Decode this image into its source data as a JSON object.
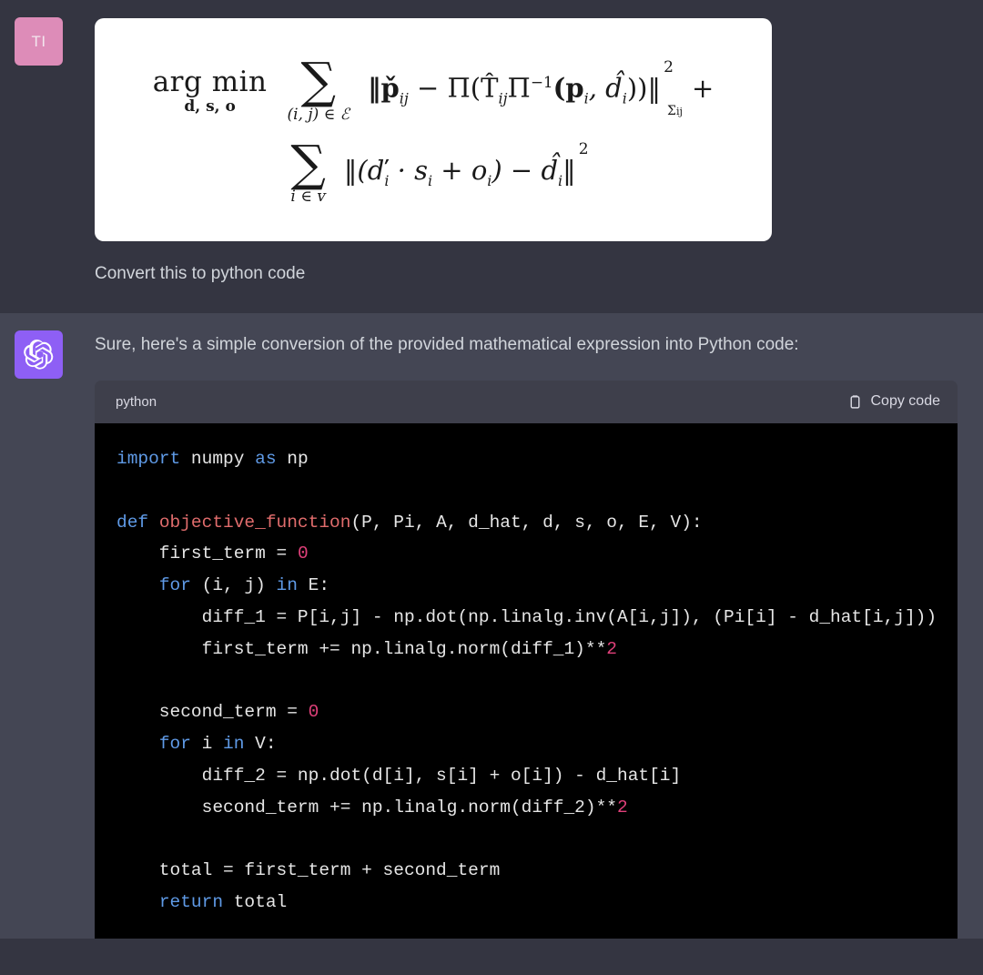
{
  "user_message": {
    "avatar_initials": "TI",
    "avatar_color": "#dd8cb8",
    "equation_alt": "arg min over d, s, o of sum over (i,j) in E of norm(p_check_ij - Pi(T_hat_ij Pi^-1(p_i, d_hat_i)))^2_Sigma_ij + sum over i in V of norm((d_check_i * s_i + o_i) - d_hat_i)^2",
    "equation": {
      "line1": {
        "argmin_top": "arg min",
        "argmin_bottom": "d, s, o",
        "sum_glyph": "∑",
        "sum_subscript": "(i, j) ∈ ℰ",
        "body_prefix": "‖p̌",
        "body_sub1": "ij",
        "body_mid": " − Π(T̂",
        "body_sub2": "ij",
        "body_mid2": "Π",
        "body_pow": "−1",
        "body_mid3": "(p",
        "body_sub3": "i",
        "body_mid4": ", d̂",
        "body_sub4": "i",
        "body_mid5": "))‖",
        "norm_power": "2",
        "norm_subscript": "Σ",
        "norm_subscript_idx": "ij",
        "trailing_plus": "+"
      },
      "line2": {
        "sum_glyph": "∑",
        "sum_subscript": "i ∈ ᴠ",
        "body_prefix": "‖(ď",
        "body_sub1": "i",
        "body_mid": " · s",
        "body_sub2": "i",
        "body_mid2": " + o",
        "body_sub3": "i",
        "body_mid3": ") − d̂",
        "body_sub4": "i",
        "body_suffix": "‖",
        "norm_power": "2"
      }
    },
    "text": "Convert this to python code"
  },
  "assistant_message": {
    "avatar_color": "#8e5ff5",
    "avatar_icon": "openai-logo-icon",
    "text": "Sure, here's a simple conversion of the provided mathematical expression into Python code:",
    "code_block": {
      "language": "python",
      "copy_label": "Copy code",
      "copy_icon": "clipboard-icon",
      "lines": [
        [
          {
            "t": "import",
            "c": "kw"
          },
          {
            "t": " numpy ",
            "c": "pl"
          },
          {
            "t": "as",
            "c": "kw"
          },
          {
            "t": " np",
            "c": "pl"
          }
        ],
        [],
        [
          {
            "t": "def",
            "c": "kw"
          },
          {
            "t": " ",
            "c": "pl"
          },
          {
            "t": "objective_function",
            "c": "fn"
          },
          {
            "t": "(P, Pi, A, d_hat, d, s, o, E, V):",
            "c": "pl"
          }
        ],
        [
          {
            "t": "    first_term = ",
            "c": "pl"
          },
          {
            "t": "0",
            "c": "num"
          }
        ],
        [
          {
            "t": "    ",
            "c": "pl"
          },
          {
            "t": "for",
            "c": "kw"
          },
          {
            "t": " (i, j) ",
            "c": "pl"
          },
          {
            "t": "in",
            "c": "kw"
          },
          {
            "t": " E:",
            "c": "pl"
          }
        ],
        [
          {
            "t": "        diff_1 = P[i,j] - np.dot(np.linalg.inv(A[i,j]), (Pi[i] - d_hat[i,j]))",
            "c": "pl"
          }
        ],
        [
          {
            "t": "        first_term += np.linalg.norm(diff_1)**",
            "c": "pl"
          },
          {
            "t": "2",
            "c": "num"
          }
        ],
        [],
        [
          {
            "t": "    second_term = ",
            "c": "pl"
          },
          {
            "t": "0",
            "c": "num"
          }
        ],
        [
          {
            "t": "    ",
            "c": "pl"
          },
          {
            "t": "for",
            "c": "kw"
          },
          {
            "t": " i ",
            "c": "pl"
          },
          {
            "t": "in",
            "c": "kw"
          },
          {
            "t": " V:",
            "c": "pl"
          }
        ],
        [
          {
            "t": "        diff_2 = np.dot(d[i], s[i] + o[i]) - d_hat[i]",
            "c": "pl"
          }
        ],
        [
          {
            "t": "        second_term += np.linalg.norm(diff_2)**",
            "c": "pl"
          },
          {
            "t": "2",
            "c": "num"
          }
        ],
        [],
        [
          {
            "t": "    total = first_term + second_term",
            "c": "pl"
          }
        ],
        [
          {
            "t": "    ",
            "c": "pl"
          },
          {
            "t": "return",
            "c": "kw"
          },
          {
            "t": " total",
            "c": "pl"
          }
        ]
      ]
    }
  },
  "colors": {
    "user_bg": "#343541",
    "assistant_bg": "#444654",
    "code_header_bg": "#3e3f4b",
    "code_body_bg": "#000000",
    "text": "#d1d5db",
    "keyword": "#5f9ae6",
    "function": "#e06c6c",
    "number": "#e0407a"
  }
}
